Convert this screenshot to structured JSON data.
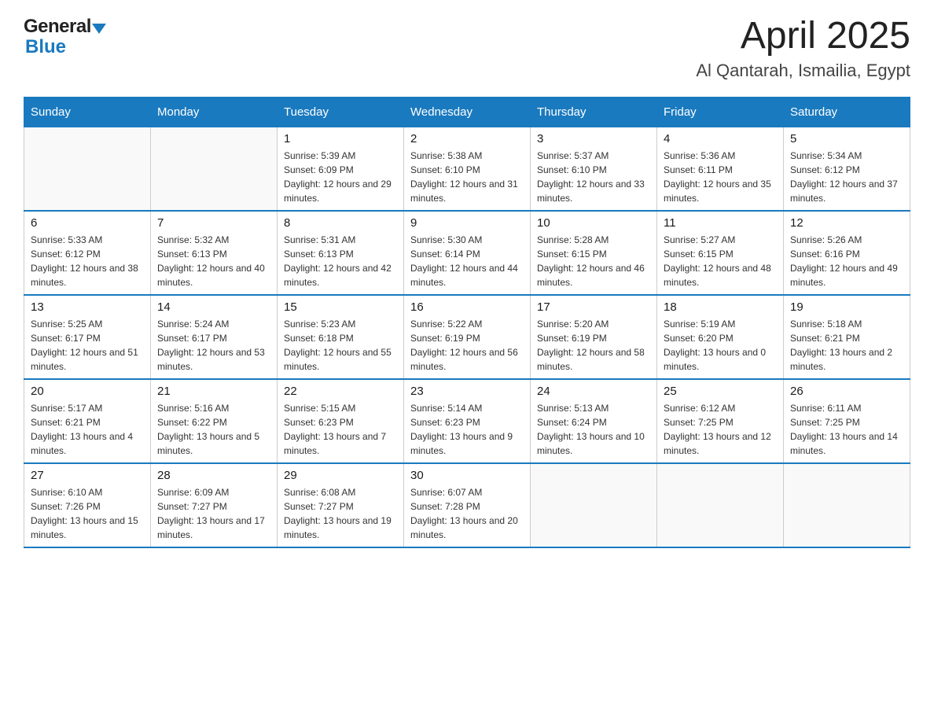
{
  "header": {
    "logo_general": "General",
    "logo_blue": "Blue",
    "title": "April 2025",
    "subtitle": "Al Qantarah, Ismailia, Egypt"
  },
  "calendar": {
    "days_of_week": [
      "Sunday",
      "Monday",
      "Tuesday",
      "Wednesday",
      "Thursday",
      "Friday",
      "Saturday"
    ],
    "weeks": [
      [
        {
          "day": "",
          "sunrise": "",
          "sunset": "",
          "daylight": ""
        },
        {
          "day": "",
          "sunrise": "",
          "sunset": "",
          "daylight": ""
        },
        {
          "day": "1",
          "sunrise": "Sunrise: 5:39 AM",
          "sunset": "Sunset: 6:09 PM",
          "daylight": "Daylight: 12 hours and 29 minutes."
        },
        {
          "day": "2",
          "sunrise": "Sunrise: 5:38 AM",
          "sunset": "Sunset: 6:10 PM",
          "daylight": "Daylight: 12 hours and 31 minutes."
        },
        {
          "day": "3",
          "sunrise": "Sunrise: 5:37 AM",
          "sunset": "Sunset: 6:10 PM",
          "daylight": "Daylight: 12 hours and 33 minutes."
        },
        {
          "day": "4",
          "sunrise": "Sunrise: 5:36 AM",
          "sunset": "Sunset: 6:11 PM",
          "daylight": "Daylight: 12 hours and 35 minutes."
        },
        {
          "day": "5",
          "sunrise": "Sunrise: 5:34 AM",
          "sunset": "Sunset: 6:12 PM",
          "daylight": "Daylight: 12 hours and 37 minutes."
        }
      ],
      [
        {
          "day": "6",
          "sunrise": "Sunrise: 5:33 AM",
          "sunset": "Sunset: 6:12 PM",
          "daylight": "Daylight: 12 hours and 38 minutes."
        },
        {
          "day": "7",
          "sunrise": "Sunrise: 5:32 AM",
          "sunset": "Sunset: 6:13 PM",
          "daylight": "Daylight: 12 hours and 40 minutes."
        },
        {
          "day": "8",
          "sunrise": "Sunrise: 5:31 AM",
          "sunset": "Sunset: 6:13 PM",
          "daylight": "Daylight: 12 hours and 42 minutes."
        },
        {
          "day": "9",
          "sunrise": "Sunrise: 5:30 AM",
          "sunset": "Sunset: 6:14 PM",
          "daylight": "Daylight: 12 hours and 44 minutes."
        },
        {
          "day": "10",
          "sunrise": "Sunrise: 5:28 AM",
          "sunset": "Sunset: 6:15 PM",
          "daylight": "Daylight: 12 hours and 46 minutes."
        },
        {
          "day": "11",
          "sunrise": "Sunrise: 5:27 AM",
          "sunset": "Sunset: 6:15 PM",
          "daylight": "Daylight: 12 hours and 48 minutes."
        },
        {
          "day": "12",
          "sunrise": "Sunrise: 5:26 AM",
          "sunset": "Sunset: 6:16 PM",
          "daylight": "Daylight: 12 hours and 49 minutes."
        }
      ],
      [
        {
          "day": "13",
          "sunrise": "Sunrise: 5:25 AM",
          "sunset": "Sunset: 6:17 PM",
          "daylight": "Daylight: 12 hours and 51 minutes."
        },
        {
          "day": "14",
          "sunrise": "Sunrise: 5:24 AM",
          "sunset": "Sunset: 6:17 PM",
          "daylight": "Daylight: 12 hours and 53 minutes."
        },
        {
          "day": "15",
          "sunrise": "Sunrise: 5:23 AM",
          "sunset": "Sunset: 6:18 PM",
          "daylight": "Daylight: 12 hours and 55 minutes."
        },
        {
          "day": "16",
          "sunrise": "Sunrise: 5:22 AM",
          "sunset": "Sunset: 6:19 PM",
          "daylight": "Daylight: 12 hours and 56 minutes."
        },
        {
          "day": "17",
          "sunrise": "Sunrise: 5:20 AM",
          "sunset": "Sunset: 6:19 PM",
          "daylight": "Daylight: 12 hours and 58 minutes."
        },
        {
          "day": "18",
          "sunrise": "Sunrise: 5:19 AM",
          "sunset": "Sunset: 6:20 PM",
          "daylight": "Daylight: 13 hours and 0 minutes."
        },
        {
          "day": "19",
          "sunrise": "Sunrise: 5:18 AM",
          "sunset": "Sunset: 6:21 PM",
          "daylight": "Daylight: 13 hours and 2 minutes."
        }
      ],
      [
        {
          "day": "20",
          "sunrise": "Sunrise: 5:17 AM",
          "sunset": "Sunset: 6:21 PM",
          "daylight": "Daylight: 13 hours and 4 minutes."
        },
        {
          "day": "21",
          "sunrise": "Sunrise: 5:16 AM",
          "sunset": "Sunset: 6:22 PM",
          "daylight": "Daylight: 13 hours and 5 minutes."
        },
        {
          "day": "22",
          "sunrise": "Sunrise: 5:15 AM",
          "sunset": "Sunset: 6:23 PM",
          "daylight": "Daylight: 13 hours and 7 minutes."
        },
        {
          "day": "23",
          "sunrise": "Sunrise: 5:14 AM",
          "sunset": "Sunset: 6:23 PM",
          "daylight": "Daylight: 13 hours and 9 minutes."
        },
        {
          "day": "24",
          "sunrise": "Sunrise: 5:13 AM",
          "sunset": "Sunset: 6:24 PM",
          "daylight": "Daylight: 13 hours and 10 minutes."
        },
        {
          "day": "25",
          "sunrise": "Sunrise: 6:12 AM",
          "sunset": "Sunset: 7:25 PM",
          "daylight": "Daylight: 13 hours and 12 minutes."
        },
        {
          "day": "26",
          "sunrise": "Sunrise: 6:11 AM",
          "sunset": "Sunset: 7:25 PM",
          "daylight": "Daylight: 13 hours and 14 minutes."
        }
      ],
      [
        {
          "day": "27",
          "sunrise": "Sunrise: 6:10 AM",
          "sunset": "Sunset: 7:26 PM",
          "daylight": "Daylight: 13 hours and 15 minutes."
        },
        {
          "day": "28",
          "sunrise": "Sunrise: 6:09 AM",
          "sunset": "Sunset: 7:27 PM",
          "daylight": "Daylight: 13 hours and 17 minutes."
        },
        {
          "day": "29",
          "sunrise": "Sunrise: 6:08 AM",
          "sunset": "Sunset: 7:27 PM",
          "daylight": "Daylight: 13 hours and 19 minutes."
        },
        {
          "day": "30",
          "sunrise": "Sunrise: 6:07 AM",
          "sunset": "Sunset: 7:28 PM",
          "daylight": "Daylight: 13 hours and 20 minutes."
        },
        {
          "day": "",
          "sunrise": "",
          "sunset": "",
          "daylight": ""
        },
        {
          "day": "",
          "sunrise": "",
          "sunset": "",
          "daylight": ""
        },
        {
          "day": "",
          "sunrise": "",
          "sunset": "",
          "daylight": ""
        }
      ]
    ]
  }
}
